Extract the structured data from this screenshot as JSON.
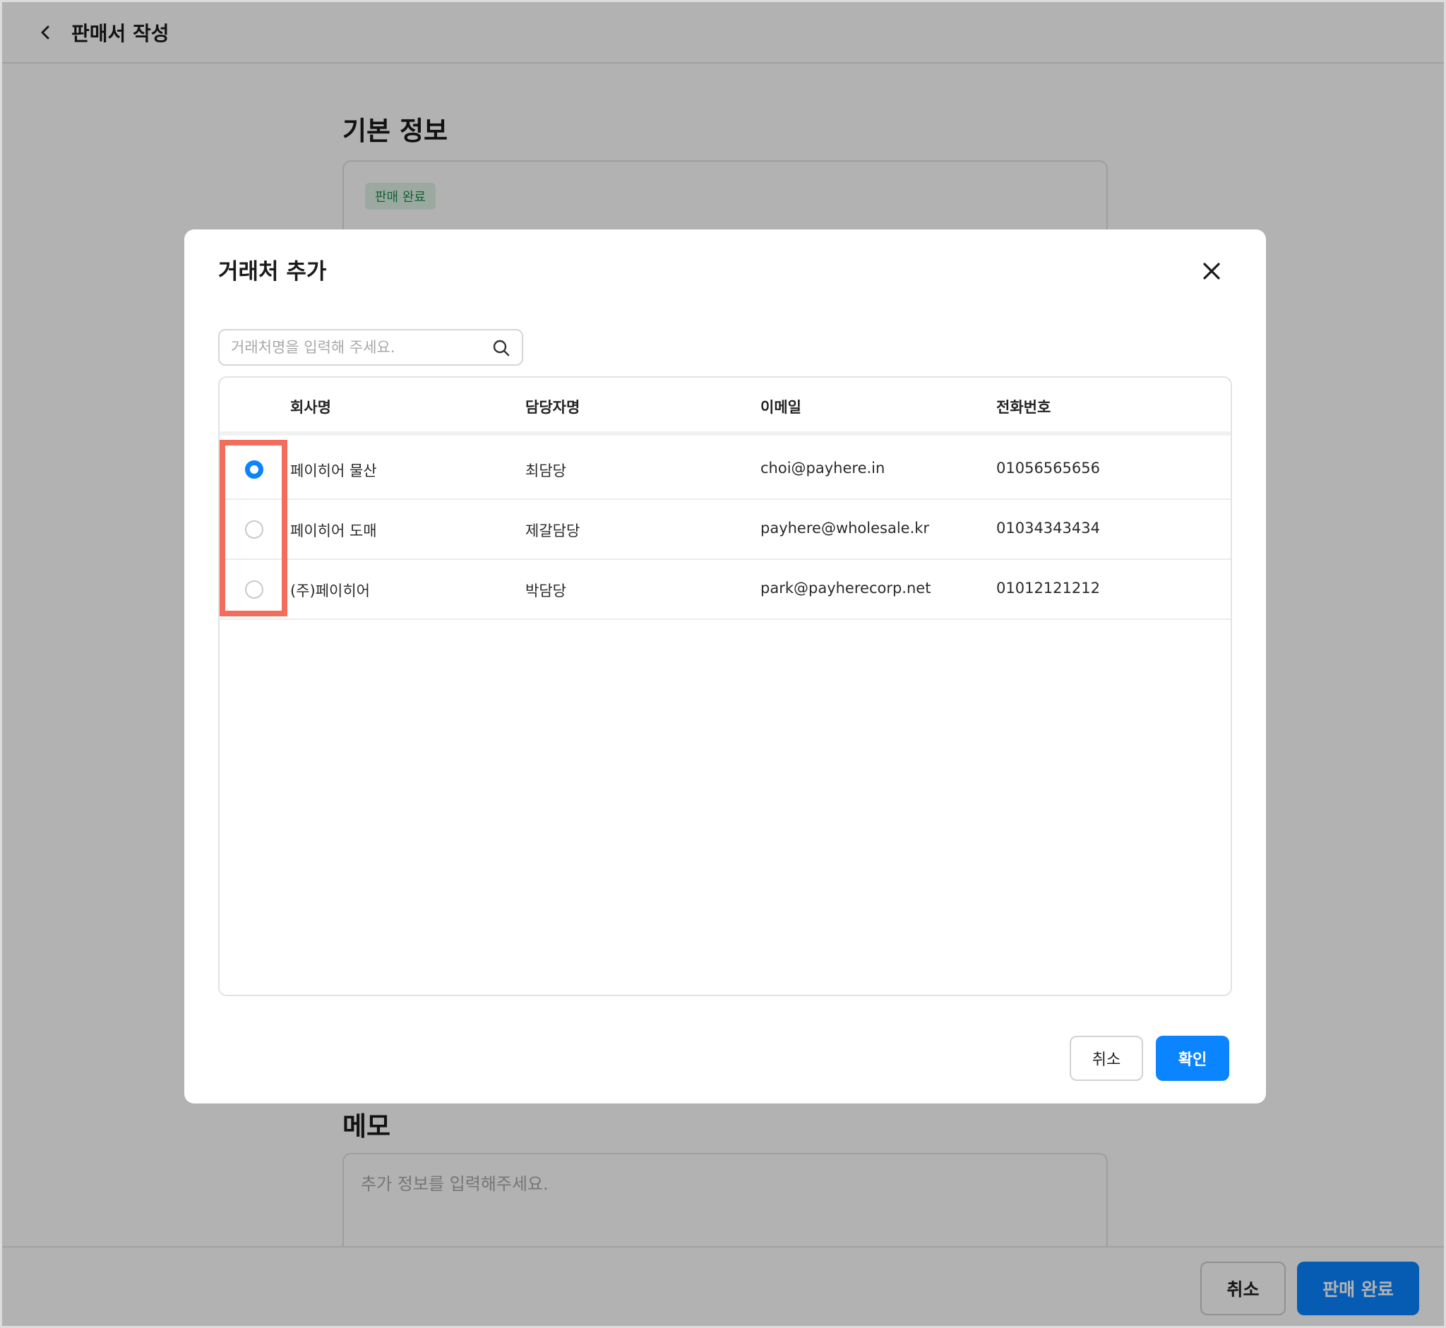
{
  "page": {
    "title": "판매서 작성",
    "basic_info_title": "기본 정보",
    "status_badge": "판매 완료",
    "memo_title": "메모",
    "memo_placeholder": "추가 정보를 입력해주세요.",
    "bottom_cancel_label": "취소",
    "bottom_complete_label": "판매 완료"
  },
  "modal": {
    "title": "거래처 추가",
    "search_placeholder": "거래처명을 입력해 주세요.",
    "columns": [
      "회사명",
      "담당자명",
      "이메일",
      "전화번호"
    ],
    "rows": [
      {
        "company": "페이히어 물산",
        "contact": "최담당",
        "email": "choi@payhere.in",
        "phone": "01056565656",
        "selected": true
      },
      {
        "company": "페이히어 도매",
        "contact": "제갈담당",
        "email": "payhere@wholesale.kr",
        "phone": "01034343434",
        "selected": false
      },
      {
        "company": "(주)페이히어",
        "contact": "박담당",
        "email": "park@payherecorp.net",
        "phone": "01012121212",
        "selected": false
      }
    ],
    "cancel_label": "취소",
    "confirm_label": "확인"
  },
  "colors": {
    "accent": "#0a84ff",
    "highlight": "#f26d5b",
    "badge_bg": "#dff3e6",
    "badge_text": "#1f8a4c"
  },
  "icons": [
    "chevron-left-icon",
    "close-icon",
    "search-icon"
  ]
}
